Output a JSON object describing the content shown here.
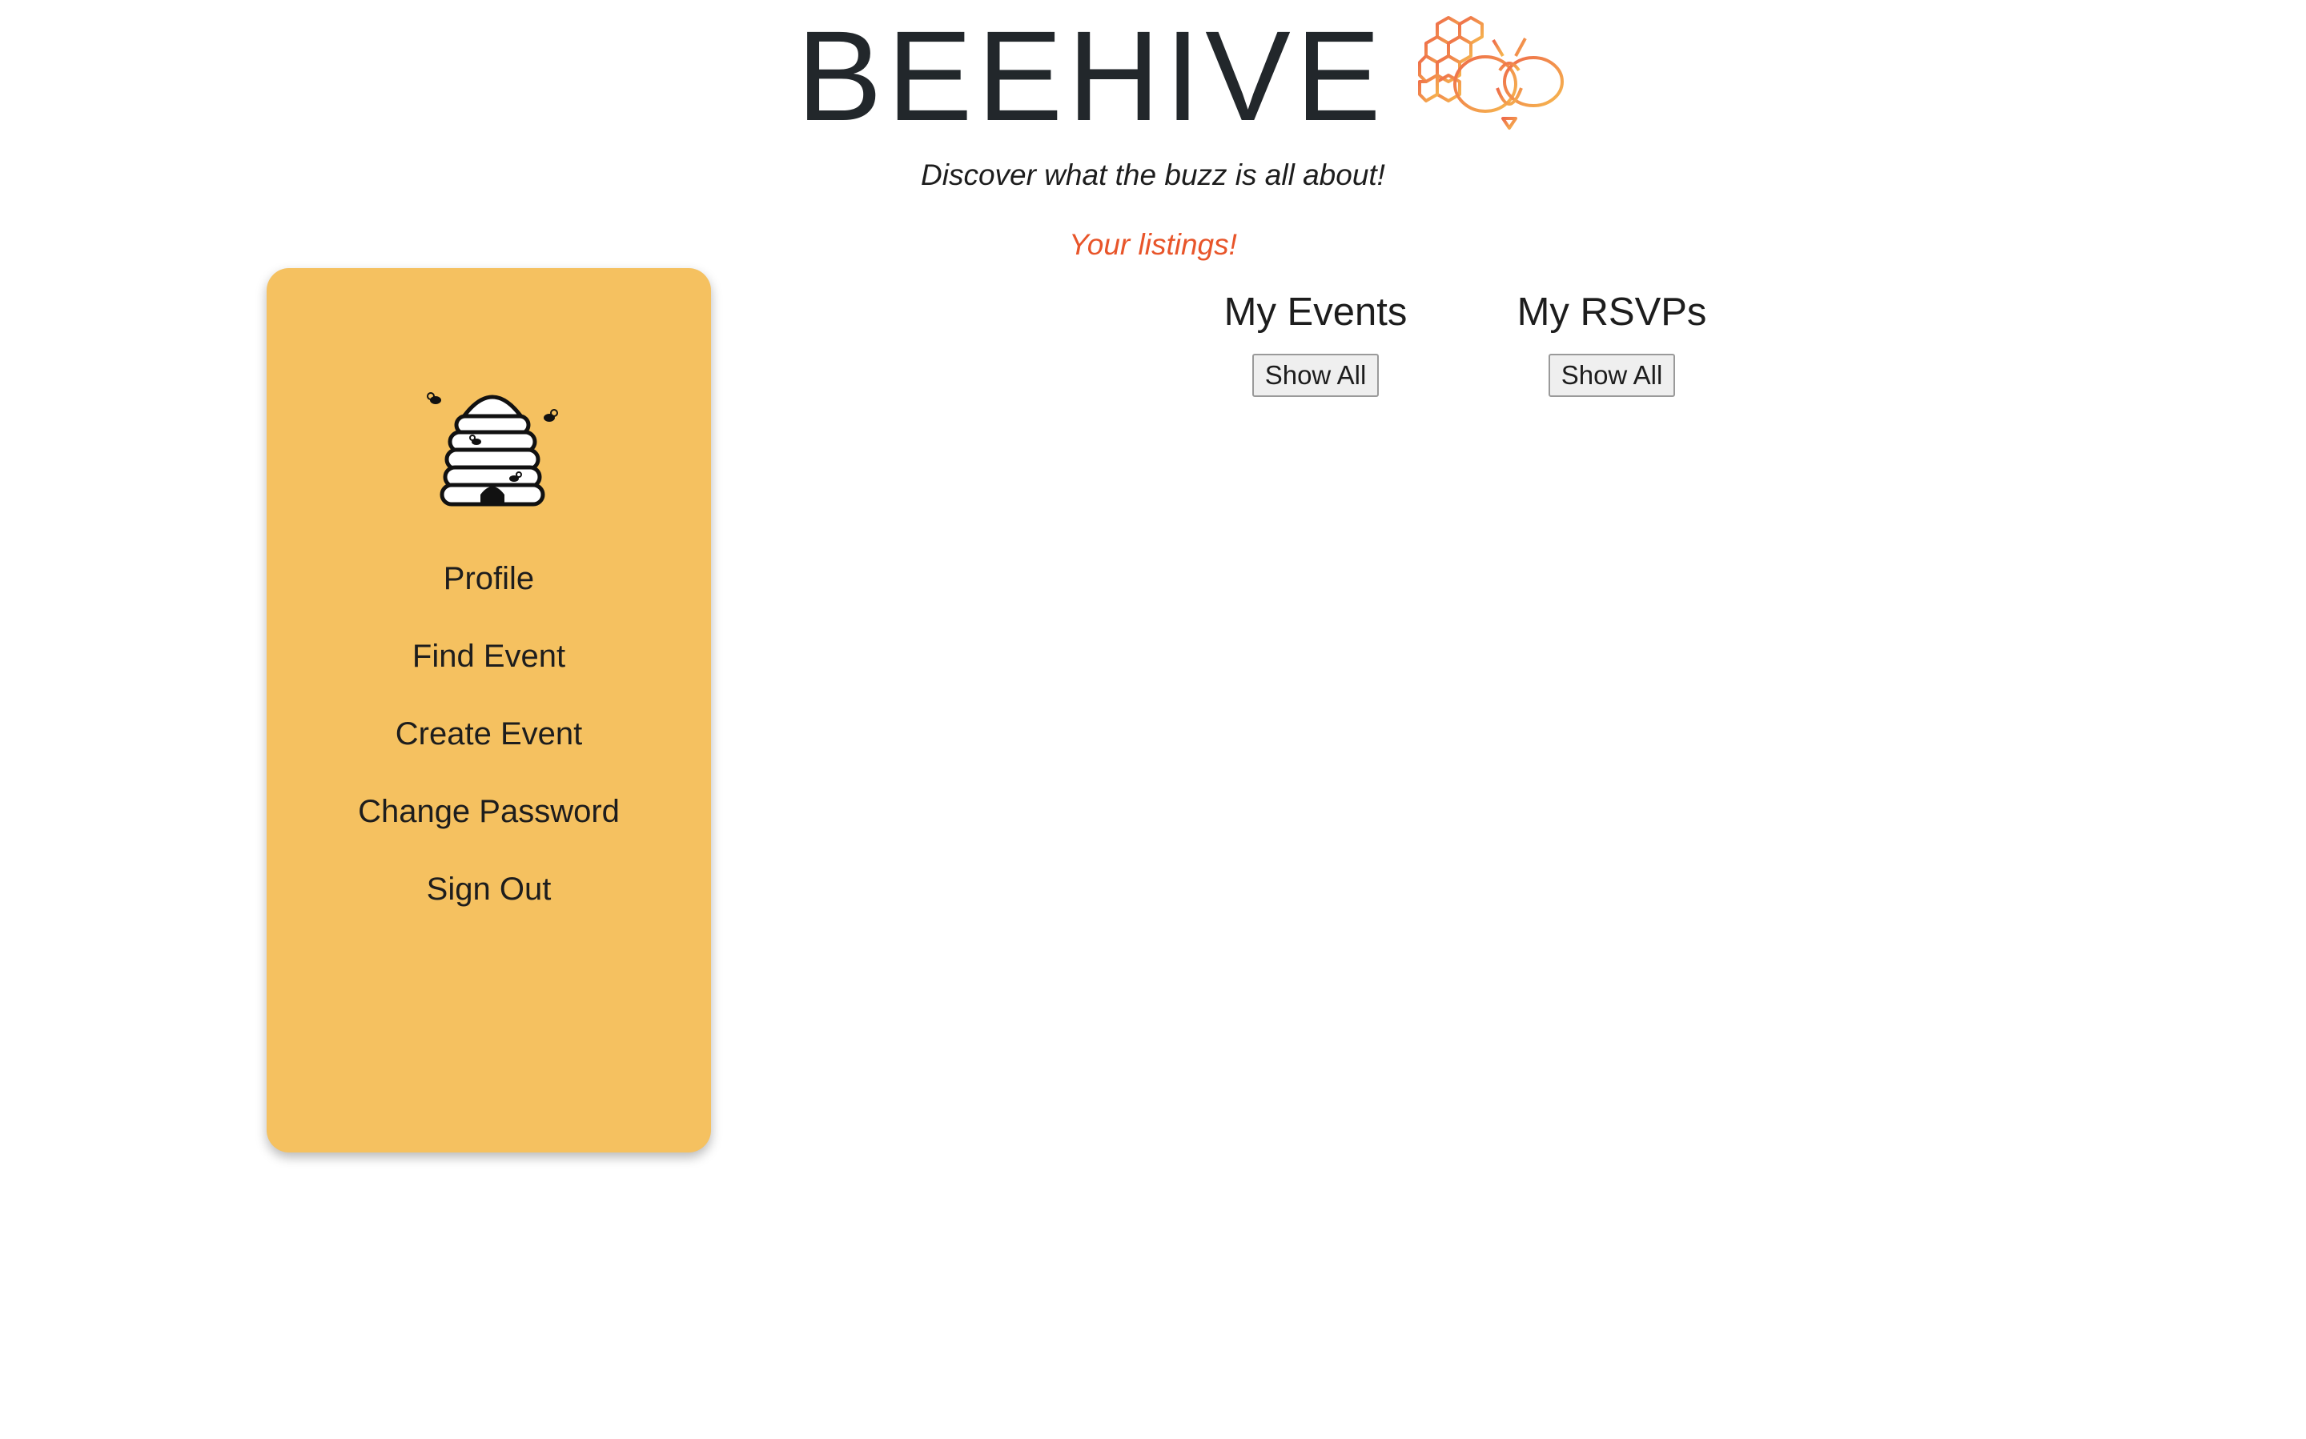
{
  "header": {
    "title": "BEEHIVE",
    "logo_icon": "honeycomb-bee-icon",
    "tagline": "Discover what the buzz is all about!",
    "listings_heading": "Your listings!"
  },
  "colors": {
    "accent": "#e8552a",
    "sidebar_bg": "#f5c160",
    "logo_orange": "#ee7a4f",
    "logo_yellow": "#f3b24f"
  },
  "sidebar": {
    "avatar_icon": "beehive-icon",
    "items": [
      {
        "label": "Profile"
      },
      {
        "label": "Find Event"
      },
      {
        "label": "Create Event"
      },
      {
        "label": "Change Password"
      },
      {
        "label": "Sign Out"
      }
    ]
  },
  "main": {
    "events": {
      "heading": "My Events",
      "button_label": "Show All"
    },
    "rsvps": {
      "heading": "My RSVPs",
      "button_label": "Show All"
    }
  }
}
